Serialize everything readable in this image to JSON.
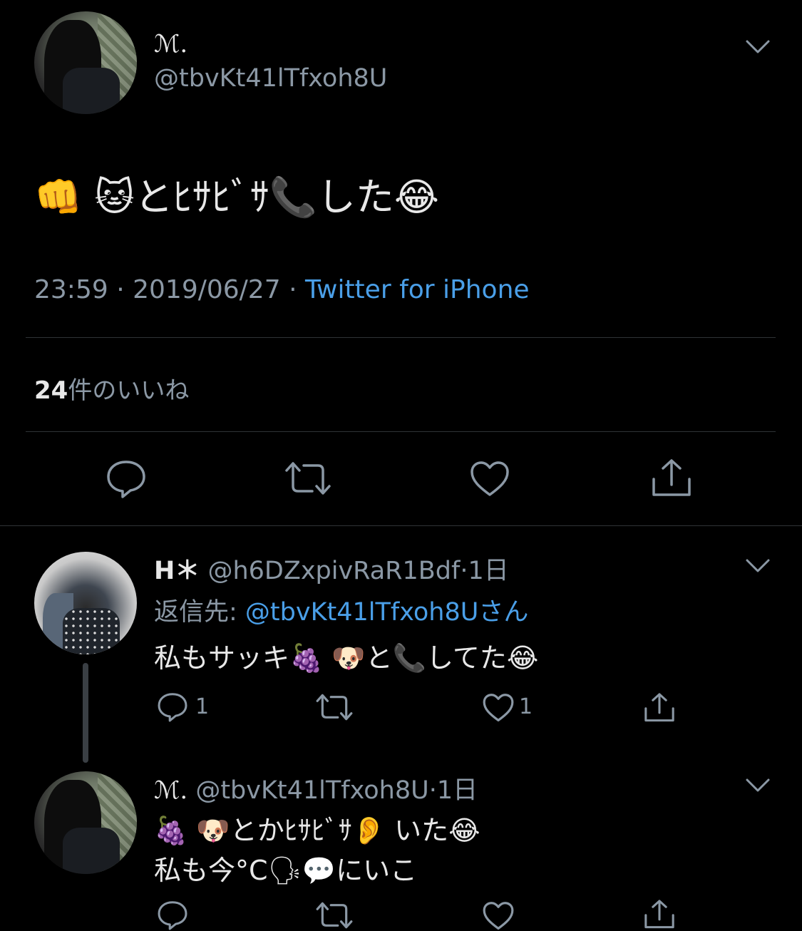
{
  "main_tweet": {
    "name": "ℳ.",
    "handle": "@tbvKt41lTfxoh8U",
    "text": "👊 🐱とﾋｻﾋﾞｻ📞した😂",
    "time": "23:59",
    "date": "2019/06/27",
    "separator": "·",
    "client": "Twitter for iPhone",
    "likes_count": "24",
    "likes_label": "件のいいね"
  },
  "replies": [
    {
      "name": "H＊",
      "handle": "@h6DZxpivRaR1Bdf",
      "age": "1日",
      "reply_to_prefix": "返信先: ",
      "reply_to_handle": "@tbvKt41lTfxoh8Uさん",
      "text": "私もサッキ🍇 🐶と📞してた😂",
      "reply_count": "1",
      "like_count": "1"
    },
    {
      "name": "ℳ.",
      "handle": "@tbvKt41lTfxoh8U",
      "age": "1日",
      "text_line1": "🍇 🐶とかﾋｻﾋﾞｻ👂 いた😂",
      "text_line2": "私も今°C🗣💬にいこ"
    }
  ],
  "icons": {
    "menu": "chevron-down-icon",
    "reply": "reply-icon",
    "retweet": "retweet-icon",
    "like": "heart-icon",
    "share": "share-icon"
  },
  "colors": {
    "background": "#000000",
    "text": "#e8e8e8",
    "secondary": "#8b98a5",
    "link": "#4a9fe8",
    "divider": "#2f3336"
  }
}
